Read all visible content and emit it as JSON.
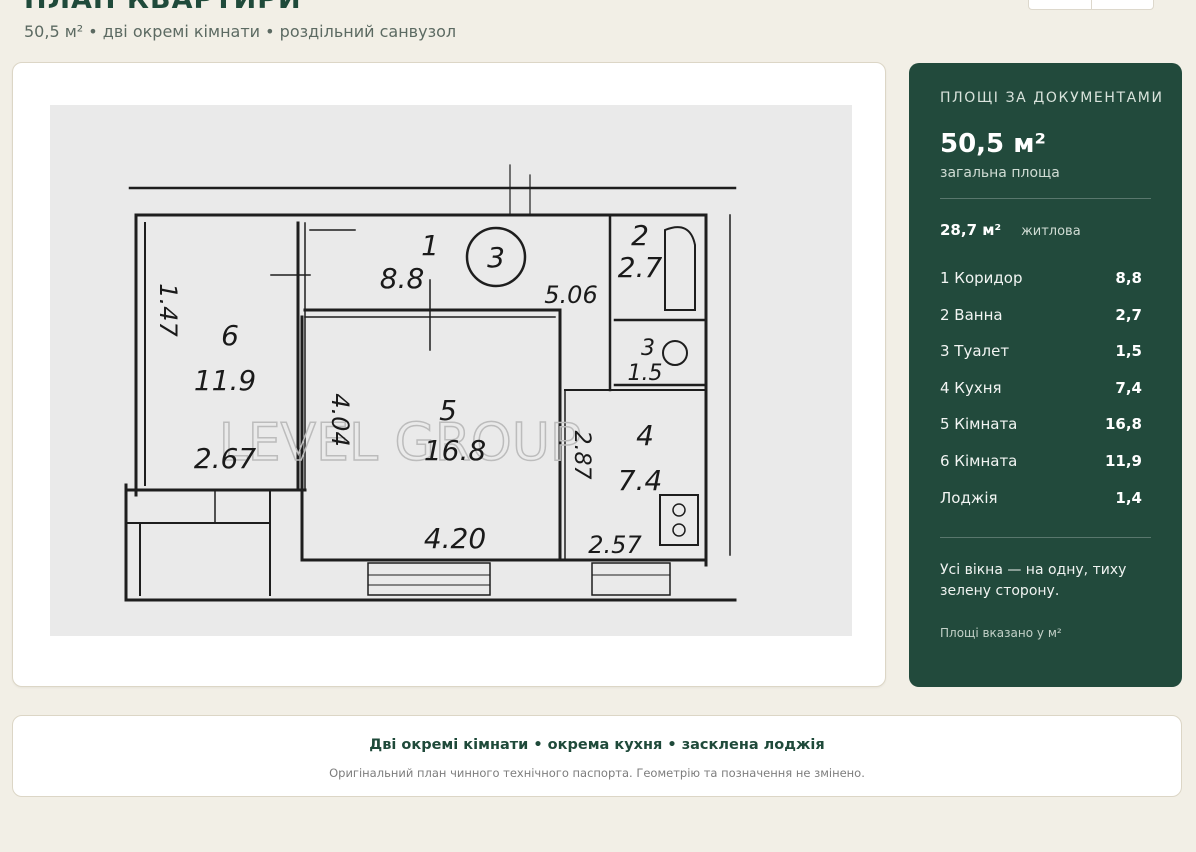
{
  "header": {
    "title": "ПЛАН КВАРТИРИ",
    "subtitle": "50,5 м² • дві окремі кімнати • роздільний санвузол"
  },
  "plan_image": {
    "watermark": "LEVEL GROUP",
    "labels": {
      "room1_num": "1",
      "room1_area": "8.8",
      "room2_num": "2",
      "room2_area": "2.7",
      "room3_num": "3",
      "room3_area": "1.5",
      "room4_num": "4",
      "room4_area": "7.4",
      "room5_num": "5",
      "room5_area": "16.8",
      "room6_num": "6",
      "room6_area": "11.9",
      "circle": "3",
      "dim_5_06": "5.06",
      "dim_1_47": "1.47",
      "dim_2_67": "2.67",
      "dim_4_04": "4.04",
      "dim_4_20": "4.20",
      "dim_2_87": "2.87",
      "dim_2_57": "2.57"
    }
  },
  "panel": {
    "heading": "ПЛОЩІ ЗА ДОКУМЕНТАМИ",
    "total_value": "50,5 м²",
    "total_label": "загальна площа",
    "living_value": "28,7 м²",
    "living_label": "житлова",
    "rooms": [
      {
        "name": "1 Коридор",
        "area": "8,8"
      },
      {
        "name": "2 Ванна",
        "area": "2,7"
      },
      {
        "name": "3 Туалет",
        "area": "1,5"
      },
      {
        "name": "4 Кухня",
        "area": "7,4"
      },
      {
        "name": "5 Кімната",
        "area": "16,8"
      },
      {
        "name": "6 Кімната",
        "area": "11,9"
      },
      {
        "name": "Лоджія",
        "area": "1,4"
      }
    ],
    "note": "Усі вікна — на одну, тиху зелену сторону.",
    "units_note": "Площі вказано у м²"
  },
  "features": {
    "line": "Дві окремі кімнати • окрема кухня • засклена лоджія",
    "disclaimer": "Оригінальний план чинного технічного паспорта. Геометрію та позначення не змінено."
  },
  "colors": {
    "panel_bg": "#224a3c",
    "title": "#1f4a3a",
    "page_bg": "#f2efe6"
  }
}
